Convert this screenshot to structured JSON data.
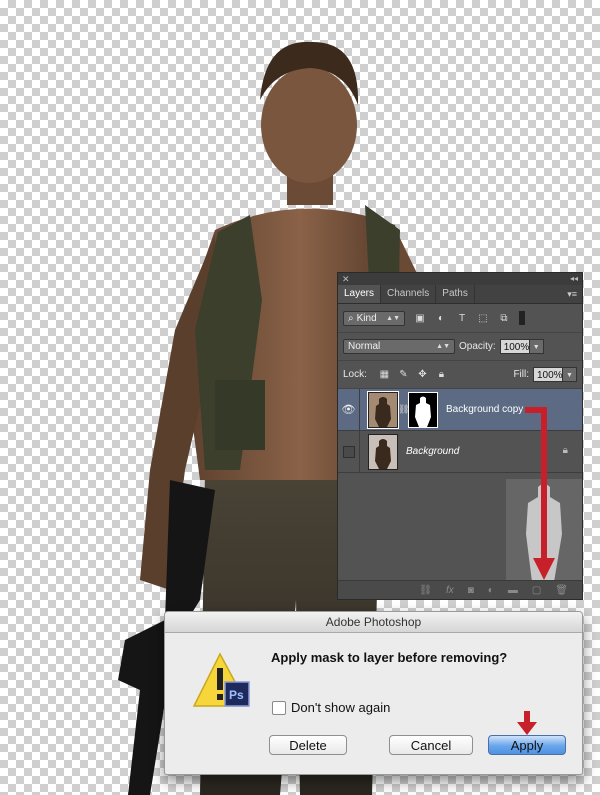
{
  "layers_panel": {
    "tabs": [
      {
        "label": "Layers",
        "active": true
      },
      {
        "label": "Channels",
        "active": false
      },
      {
        "label": "Paths",
        "active": false
      }
    ],
    "filter": {
      "kind_label": "Kind"
    },
    "blend_mode": "Normal",
    "opacity_label": "Opacity:",
    "opacity_value": "100%",
    "lock_label": "Lock:",
    "fill_label": "Fill:",
    "fill_value": "100%",
    "layers": [
      {
        "name": "Background copy",
        "selected": true,
        "visible": true,
        "has_mask": true
      },
      {
        "name": "Background",
        "selected": false,
        "visible": false,
        "locked": true
      }
    ]
  },
  "dialog": {
    "title": "Adobe Photoshop",
    "message": "Apply mask to layer before removing?",
    "checkbox_label": "Don't show again",
    "checkbox_checked": false,
    "icon_badge": "Ps",
    "buttons": {
      "delete": "Delete",
      "cancel": "Cancel",
      "apply": "Apply"
    }
  },
  "colors": {
    "annotation_arrow": "#c8202a",
    "selected_layer": "#5c6b83",
    "primary_button": "#5b9be6"
  }
}
